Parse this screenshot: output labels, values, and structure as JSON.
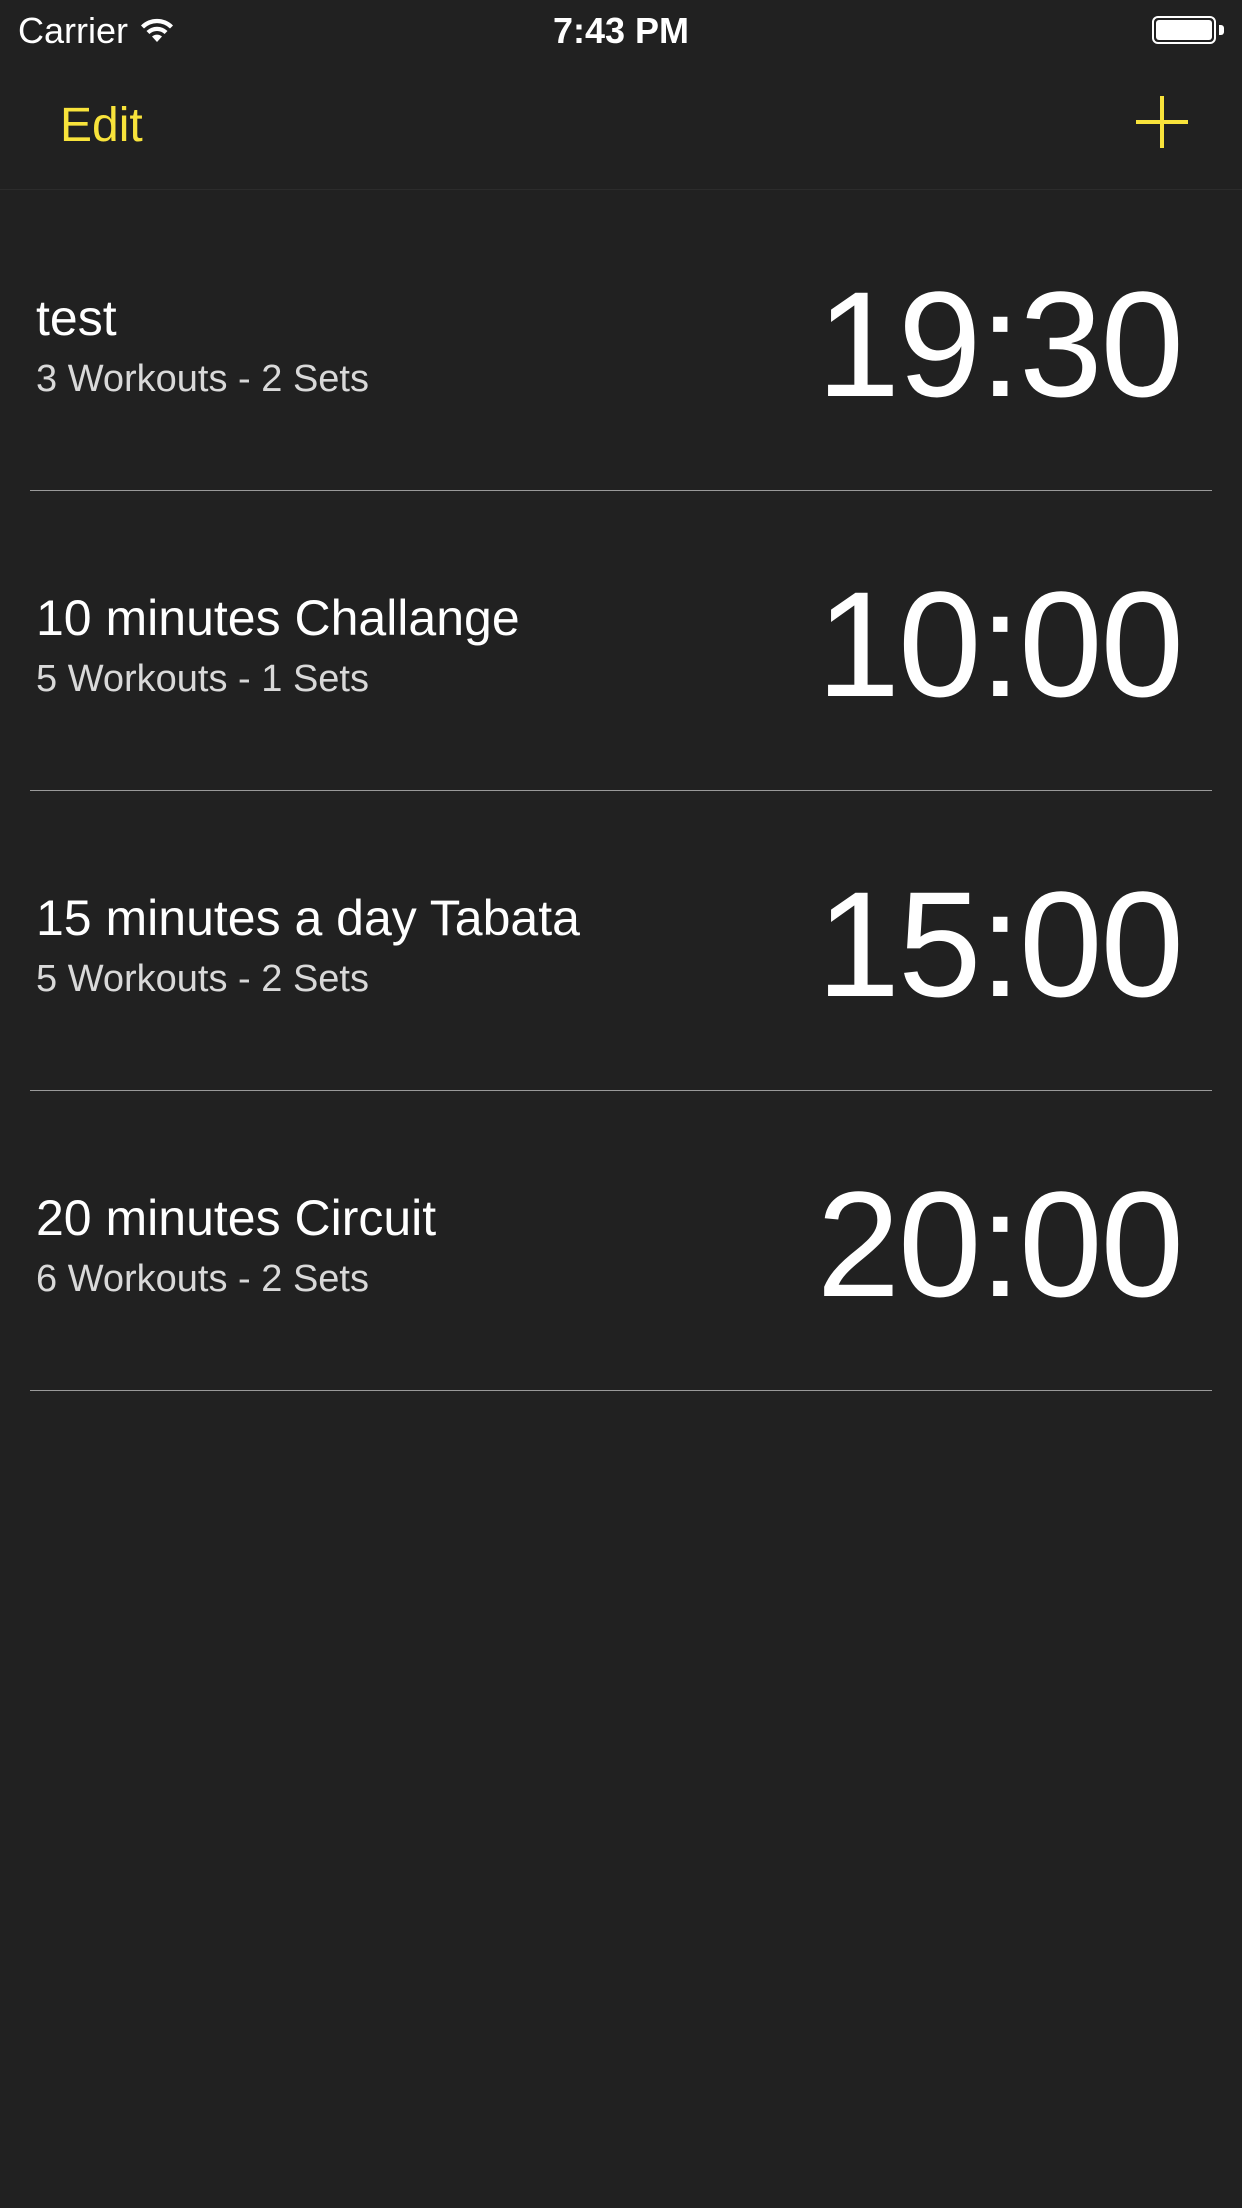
{
  "status_bar": {
    "carrier": "Carrier",
    "time": "7:43 PM",
    "wifi_icon": "wifi-icon",
    "battery_icon": "battery-icon",
    "battery_level": 1.0
  },
  "nav": {
    "edit_label": "Edit",
    "add_icon": "plus-icon",
    "accent_color": "#f8e33b"
  },
  "workouts": [
    {
      "title": "test",
      "subtitle": "3 Workouts - 2 Sets",
      "time": "19:30"
    },
    {
      "title": "10 minutes Challange",
      "subtitle": "5 Workouts - 1 Sets",
      "time": "10:00"
    },
    {
      "title": "15 minutes a day Tabata",
      "subtitle": "5 Workouts - 2 Sets",
      "time": "15:00"
    },
    {
      "title": "20 minutes Circuit",
      "subtitle": "6 Workouts - 2 Sets",
      "time": "20:00"
    }
  ],
  "colors": {
    "background": "#212121",
    "text": "#ffffff",
    "divider": "#9a9a9a"
  }
}
